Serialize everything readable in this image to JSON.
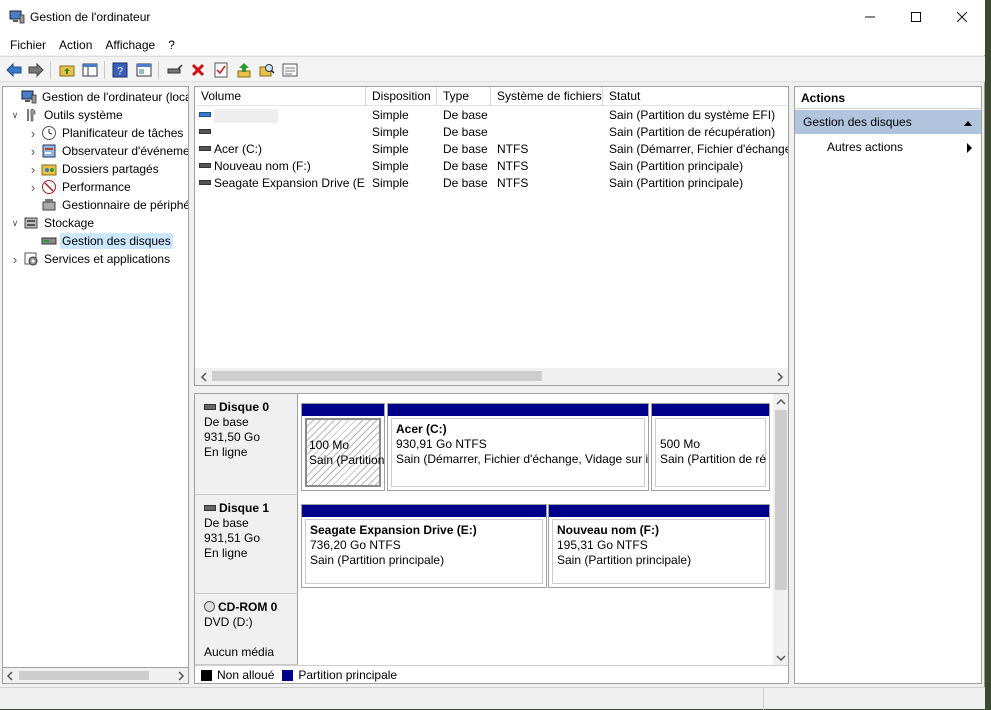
{
  "window": {
    "title": "Gestion de l'ordinateur"
  },
  "menu": [
    "Fichier",
    "Action",
    "Affichage",
    "?"
  ],
  "tree": [
    {
      "label": "Gestion de l'ordinateur (local)",
      "level": 0,
      "expand": "",
      "icon": "computer-management-icon"
    },
    {
      "label": "Outils système",
      "level": 1,
      "expand": "open",
      "icon": "system-tools-icon"
    },
    {
      "label": "Planificateur de tâches",
      "level": 2,
      "expand": "closed",
      "icon": "task-scheduler-icon"
    },
    {
      "label": "Observateur d'événements",
      "level": 2,
      "expand": "closed",
      "icon": "event-viewer-icon"
    },
    {
      "label": "Dossiers partagés",
      "level": 2,
      "expand": "closed",
      "icon": "shared-folders-icon"
    },
    {
      "label": "Performance",
      "level": 2,
      "expand": "closed",
      "icon": "performance-icon"
    },
    {
      "label": "Gestionnaire de périphériques",
      "level": 2,
      "expand": "",
      "icon": "device-manager-icon"
    },
    {
      "label": "Stockage",
      "level": 1,
      "expand": "open",
      "icon": "storage-icon"
    },
    {
      "label": "Gestion des disques",
      "level": 2,
      "expand": "",
      "icon": "disk-management-icon",
      "selected": true
    },
    {
      "label": "Services et applications",
      "level": 1,
      "expand": "closed",
      "icon": "services-icon"
    }
  ],
  "volumes": {
    "columns": [
      "Volume",
      "Disposition",
      "Type",
      "Système de fichiers",
      "Statut"
    ],
    "rows": [
      {
        "volume": "",
        "layout": "Simple",
        "type": "De base",
        "fs": "",
        "status": "Sain (Partition du système EFI)",
        "icon": "blue"
      },
      {
        "volume": "",
        "layout": "Simple",
        "type": "De base",
        "fs": "",
        "status": "Sain (Partition de récupération)",
        "icon": "gray"
      },
      {
        "volume": "Acer (C:)",
        "layout": "Simple",
        "type": "De base",
        "fs": "NTFS",
        "status": "Sain (Démarrer, Fichier d'échange,",
        "icon": "gray"
      },
      {
        "volume": "Nouveau nom (F:)",
        "layout": "Simple",
        "type": "De base",
        "fs": "NTFS",
        "status": "Sain (Partition principale)",
        "icon": "gray"
      },
      {
        "volume": "Seagate Expansion Drive (E:)",
        "layout": "Simple",
        "type": "De base",
        "fs": "NTFS",
        "status": "Sain (Partition principale)",
        "icon": "gray"
      }
    ]
  },
  "disks": [
    {
      "name": "Disque 0",
      "kind": "De base",
      "size": "931,50 Go",
      "state": "En ligne",
      "partitions": [
        {
          "title": "",
          "line1": "100 Mo",
          "line2": "Sain (Partition",
          "efi": true
        },
        {
          "title": "Acer  (C:)",
          "line1": "930,91 Go NTFS",
          "line2": "Sain (Démarrer, Fichier d'échange, Vidage sur in"
        },
        {
          "title": "",
          "line1": "500 Mo",
          "line2": "Sain (Partition de ré"
        }
      ]
    },
    {
      "name": "Disque 1",
      "kind": "De base",
      "size": "931,51 Go",
      "state": "En ligne",
      "partitions": [
        {
          "title": "Seagate Expansion Drive  (E:)",
          "line1": "736,20 Go NTFS",
          "line2": "Sain (Partition principale)"
        },
        {
          "title": "Nouveau nom  (F:)",
          "line1": "195,31 Go NTFS",
          "line2": "Sain (Partition principale)"
        }
      ]
    },
    {
      "name": "CD-ROM 0",
      "kind": "DVD (D:)",
      "size": "",
      "state": "Aucun média",
      "partitions": []
    }
  ],
  "legend": [
    {
      "label": "Non alloué",
      "color": "#000000"
    },
    {
      "label": "Partition principale",
      "color": "#00008b"
    }
  ],
  "actions": {
    "header": "Actions",
    "section": "Gestion des disques",
    "item": "Autres actions"
  }
}
